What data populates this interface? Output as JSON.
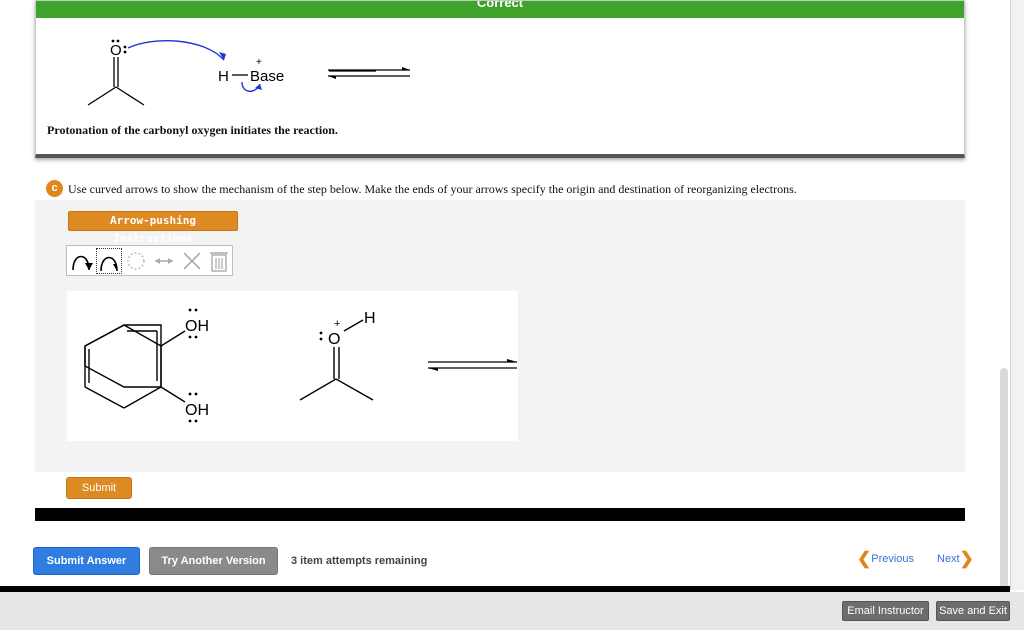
{
  "feedback": {
    "banner": "Correct",
    "text": "Protonation of the carbonyl oxygen initiates the reaction.",
    "molecule_labels": {
      "oxygen": "O",
      "hydrogen": "H",
      "base": "Base",
      "charge": "+"
    }
  },
  "part_c": {
    "badge": "c",
    "question": "Use curved arrows to show the mechanism of the step below. Make the ends of your arrows specify the origin and destination of reorganizing electrons.",
    "instructions_button": "Arrow-pushing Instructions",
    "toolbar_icons": [
      "double-barbed-arrow-icon",
      "single-barbed-arrow-icon",
      "lasso-icon",
      "resonance-arrow-icon",
      "delete-icon",
      "trash-icon"
    ],
    "molecule_labels": {
      "oh_top": "OH",
      "oh_bottom": "OH",
      "oxygen": "O",
      "hydrogen": "H",
      "charge": "+"
    },
    "submit": "Submit"
  },
  "footer_actions": {
    "submit_answer": "Submit Answer",
    "try_another": "Try Another Version",
    "attempts": "3 item attempts remaining",
    "previous": "Previous",
    "next": "Next",
    "email_instructor": "Email Instructor",
    "save_and_exit": "Save and Exit"
  },
  "colors": {
    "correct_green": "#3fa22b",
    "accent_orange": "#dd8a22",
    "primary_blue": "#2f7de1",
    "secondary_gray": "#8a8a8a",
    "arrow_blue": "#2233dd"
  }
}
